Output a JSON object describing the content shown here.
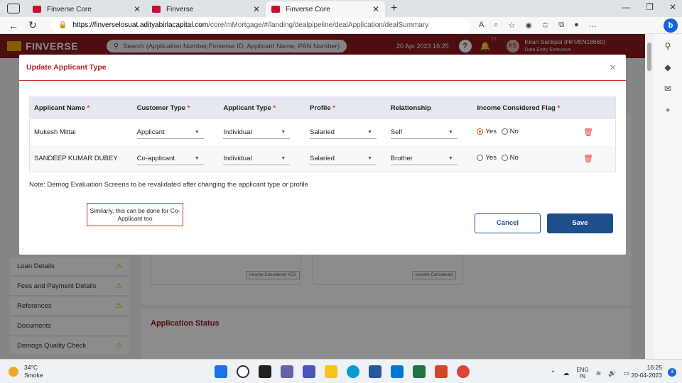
{
  "browser": {
    "tabs": [
      {
        "label": "Finverse Core",
        "active": false
      },
      {
        "label": "Finverse",
        "active": false
      },
      {
        "label": "Finverse Core",
        "active": true
      }
    ],
    "url_host": "https://finverselosuat.adityabirlacapital.com",
    "url_path": "/core/mMortgage/#/landing/dealpipeline/dealApplication/dealSummary"
  },
  "header": {
    "logo": "FINVERSE",
    "search_placeholder": "Search (Application Number,Finverse ID, Applicant Name, PAN Number)",
    "datetime": "20 Apr 2023 16:25",
    "notif_count": "39",
    "avatar_initials": "KS",
    "user_name": "Kiran Sankpal (HFVEN18660)",
    "user_role": "Data Entry Executive"
  },
  "sidebar": {
    "items": [
      {
        "label": "Loan Details",
        "warn": true
      },
      {
        "label": "Fees and Payment Details",
        "warn": true
      },
      {
        "label": "References",
        "warn": true
      },
      {
        "label": "Documents",
        "warn": false
      },
      {
        "label": "Demogs Quality Check",
        "warn": true
      }
    ]
  },
  "background": {
    "application_status": "Application Status",
    "badge1": "Income Considered YES",
    "badge2": "Income Considered"
  },
  "modal": {
    "title": "Update Applicant Type",
    "columns": [
      {
        "label": "Applicant Name",
        "required": true
      },
      {
        "label": "Customer Type",
        "required": true
      },
      {
        "label": "Applicant Type",
        "required": true
      },
      {
        "label": "Profile",
        "required": true
      },
      {
        "label": "Relationship",
        "required": false
      },
      {
        "label": "Income Considered Flag",
        "required": true
      }
    ],
    "rows": [
      {
        "name": "Mukesh Mittal",
        "customer_type": "Applicant",
        "applicant_type": "Individual",
        "profile": "Salaried",
        "relationship": "Self",
        "income_flag": "Yes"
      },
      {
        "name": "SANDEEP KUMAR DUBEY",
        "customer_type": "Co-applicant",
        "applicant_type": "Individual",
        "profile": "Salaried",
        "relationship": "Brother",
        "income_flag": ""
      }
    ],
    "yes_label": "Yes",
    "no_label": "No",
    "note": "Note: Demog Evaluation Screens to be revalidated after changing the applicant type or profile",
    "callout": "Similarly, this can be done for Co-Applicant too",
    "cancel_label": "Cancel",
    "save_label": "Save"
  },
  "taskbar": {
    "temp": "34°C",
    "weather": "Smoke",
    "lang_top": "ENG",
    "lang_bottom": "IN",
    "time": "16:25",
    "date": "20-04-2023",
    "notif": "3"
  },
  "colors": {
    "brand": "#8b1a1a",
    "primary": "#1f4e8c",
    "accent": "#c0392b"
  }
}
